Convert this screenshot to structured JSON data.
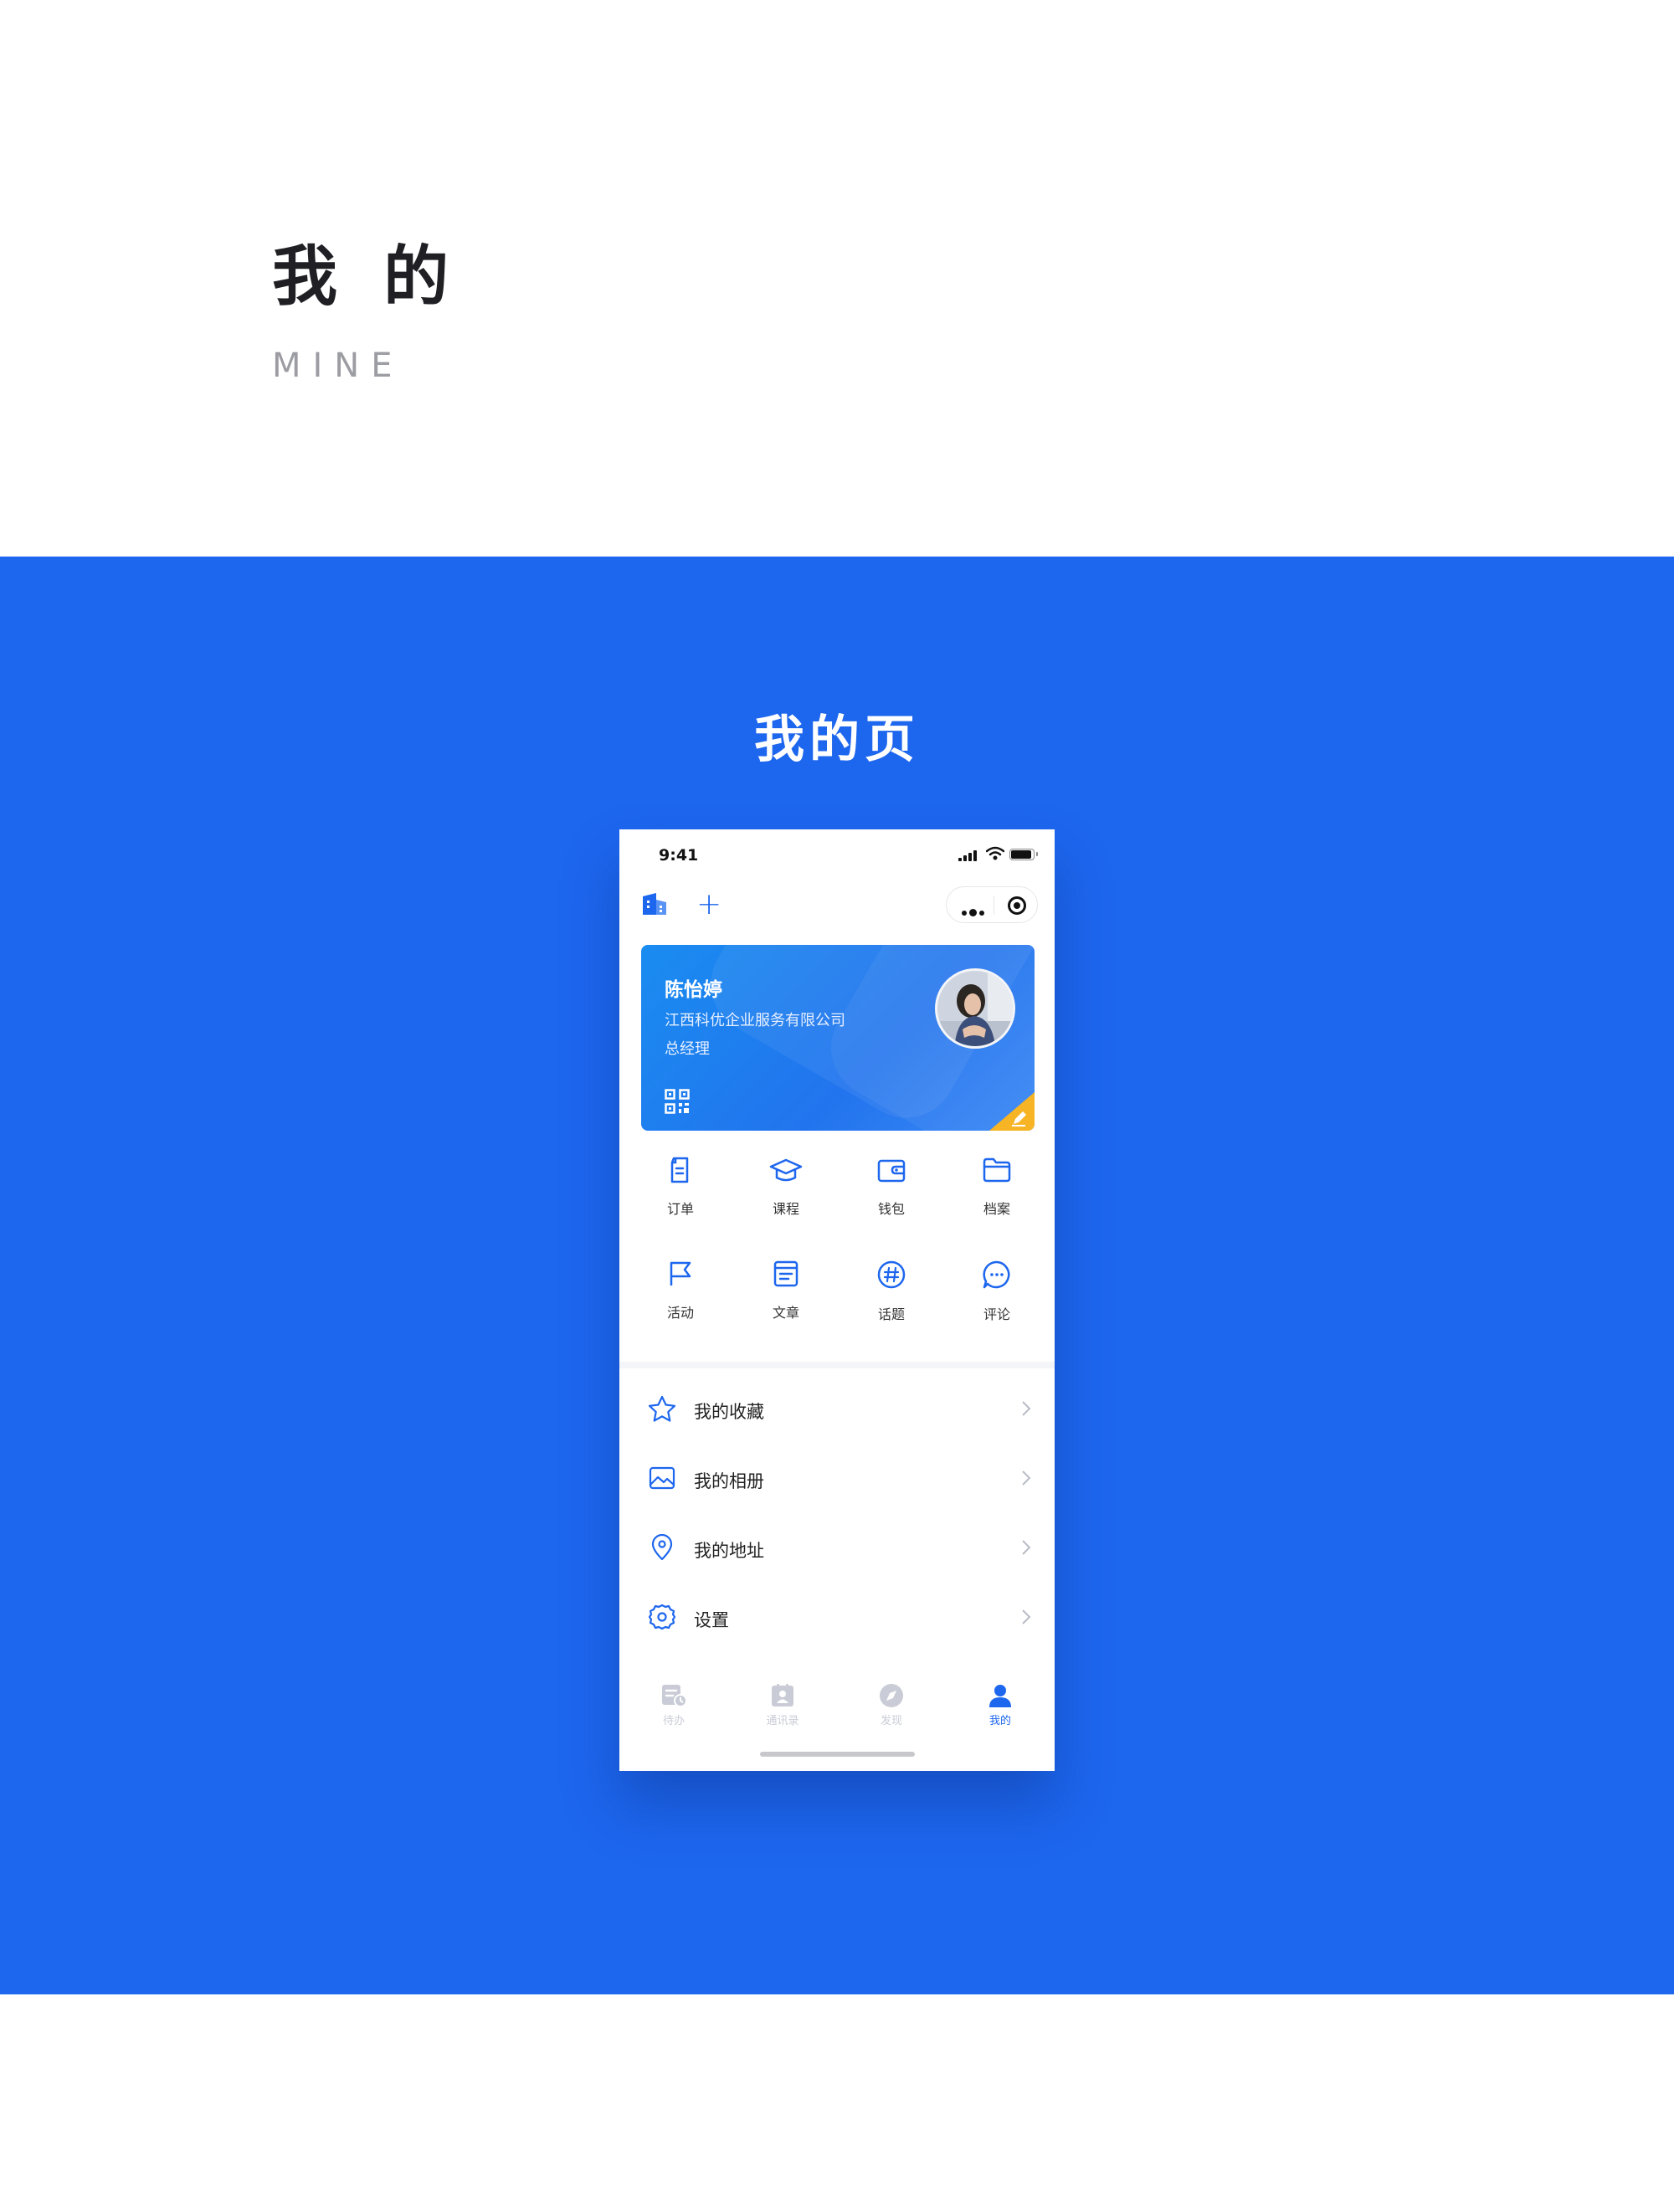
{
  "hero": {
    "title": "我 的",
    "subtitle": "MINE"
  },
  "band": {
    "title": "我的页",
    "color": "#1d66ee"
  },
  "status_bar": {
    "time": "9:41"
  },
  "navbar": {
    "org_icon": "building-icon",
    "add_icon": "plus-icon",
    "capsule_more_icon": "more-dots-icon",
    "capsule_close_icon": "target-icon"
  },
  "profile_card": {
    "name": "陈怡婷",
    "company": "江西科优企业服务有限公司",
    "role": "总经理",
    "qr_icon": "qrcode-icon",
    "edit_icon": "pencil-icon"
  },
  "shortcuts": [
    {
      "label": "订单",
      "icon": "order-icon"
    },
    {
      "label": "课程",
      "icon": "graduation-cap-icon"
    },
    {
      "label": "钱包",
      "icon": "wallet-icon"
    },
    {
      "label": "档案",
      "icon": "folder-icon"
    },
    {
      "label": "活动",
      "icon": "flag-icon"
    },
    {
      "label": "文章",
      "icon": "article-icon"
    },
    {
      "label": "话题",
      "icon": "hashtag-icon"
    },
    {
      "label": "评论",
      "icon": "comment-icon"
    }
  ],
  "menu": [
    {
      "label": "我的收藏",
      "icon": "star-icon"
    },
    {
      "label": "我的相册",
      "icon": "image-icon"
    },
    {
      "label": "我的地址",
      "icon": "location-pin-icon"
    },
    {
      "label": "设置",
      "icon": "gear-icon"
    }
  ],
  "tabbar": [
    {
      "label": "待办",
      "icon": "todo-icon",
      "active": false
    },
    {
      "label": "通讯录",
      "icon": "contacts-icon",
      "active": false
    },
    {
      "label": "发现",
      "icon": "compass-icon",
      "active": false
    },
    {
      "label": "我的",
      "icon": "user-icon",
      "active": true
    }
  ],
  "colors": {
    "brand": "#1d66ee",
    "edit_tab": "#f7b526",
    "inactive_tab": "#c9ccd6"
  }
}
